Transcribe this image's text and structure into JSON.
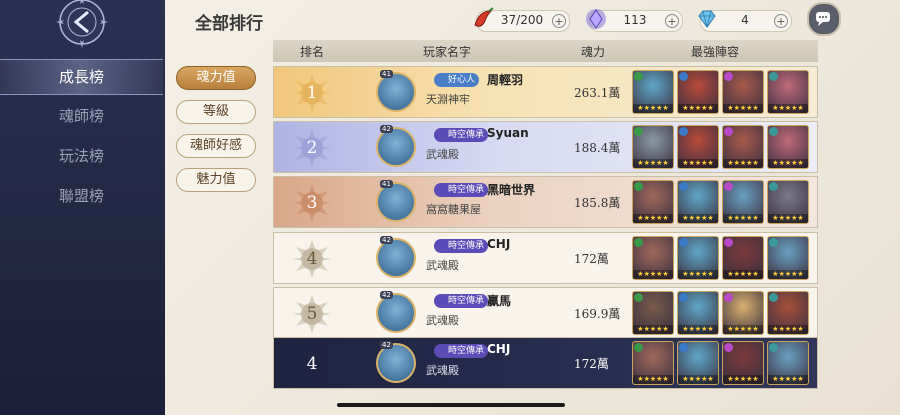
{
  "sidebar": {
    "items": [
      {
        "label": "成長榜",
        "active": true
      },
      {
        "label": "魂師榜",
        "active": false
      },
      {
        "label": "玩法榜",
        "active": false
      },
      {
        "label": "聯盟榜",
        "active": false
      }
    ]
  },
  "page_title": "全部排行",
  "resources": [
    {
      "icon": "chili-icon",
      "value": "37/200"
    },
    {
      "icon": "crystal-icon",
      "value": "113"
    },
    {
      "icon": "diamond-icon",
      "value": "4"
    }
  ],
  "table_header": {
    "rank": "排名",
    "player": "玩家名字",
    "power": "魂力",
    "team": "最強陣容"
  },
  "category_tabs": [
    {
      "label": "魂力值",
      "active": true
    },
    {
      "label": "等級",
      "active": false
    },
    {
      "label": "魂師好感",
      "active": false
    },
    {
      "label": "魅力值",
      "active": false
    }
  ],
  "rows": [
    {
      "rank": "1",
      "level": "41",
      "badge": "好心人",
      "name": "周輕羽",
      "guild": "天淵神牢",
      "power": "263.1萬"
    },
    {
      "rank": "2",
      "level": "42",
      "badge": "時空傳承",
      "name": "Syuan",
      "guild": "武魂殿",
      "power": "188.4萬"
    },
    {
      "rank": "3",
      "level": "41",
      "badge": "時空傳承",
      "name": "黑暗世界",
      "guild": "窩窩糖果屋",
      "power": "185.8萬"
    },
    {
      "rank": "4",
      "level": "42",
      "badge": "時空傳承",
      "name": "CHJ",
      "guild": "武魂殿",
      "power": "172萬"
    },
    {
      "rank": "5",
      "level": "42",
      "badge": "時空傳承",
      "name": "贏馬",
      "guild": "武魂殿",
      "power": "169.9萬"
    },
    {
      "rank": "4",
      "level": "42",
      "badge": "時空傳承",
      "name": "CHJ",
      "guild": "武魂殿",
      "power": "172萬"
    }
  ],
  "colors": {
    "sidebar_bg": "#232844",
    "gold_row": "#f3d9a4",
    "silver_row": "#cfd3ef",
    "bronze_row": "#e9c7b2",
    "self_row": "#2a2f52",
    "tab_active": "#c8914a"
  }
}
